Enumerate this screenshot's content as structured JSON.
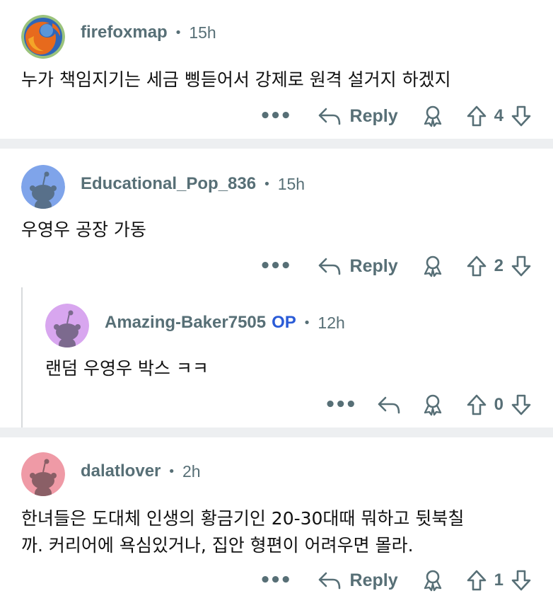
{
  "comments": [
    {
      "username": "firefoxmap",
      "time": "15h",
      "text": "누가 책임지기는 세금 삥듣어서 강제로 원격 설거지 하겠지",
      "reply_label": "Reply",
      "votes": "4",
      "avatar_icon": "firefox-logo-icon"
    },
    {
      "username": "Educational_Pop_836",
      "time": "15h",
      "text": "우영우 공장 가동",
      "reply_label": "Reply",
      "votes": "2",
      "avatar_icon": "snoo-avatar-icon",
      "avatar_color": "#7fa4ea"
    },
    {
      "username": "Amazing-Baker7505",
      "op_badge": "OP",
      "time": "12h",
      "text": "랜덤 우영우 박스 ㅋㅋ",
      "votes": "0",
      "avatar_icon": "snoo-avatar-icon",
      "avatar_color": "#d8a6ef"
    },
    {
      "username": "dalatlover",
      "time": "2h",
      "text_line1": "한녀들은 도대체 인생의 황금기인 20-30대때 뭐하고 뒷북칠",
      "text_line2": "까. 커리어에 욕심있거나, 집안 형편이 어려우면 몰라.",
      "reply_label": "Reply",
      "votes": "1",
      "avatar_icon": "snoo-avatar-icon",
      "avatar_color": "#ef9aa6"
    }
  ],
  "separator": "•",
  "more_label": "•••",
  "colors": {
    "meta": "#576f76",
    "op": "#2a5bd7",
    "divider": "#edeff1"
  }
}
